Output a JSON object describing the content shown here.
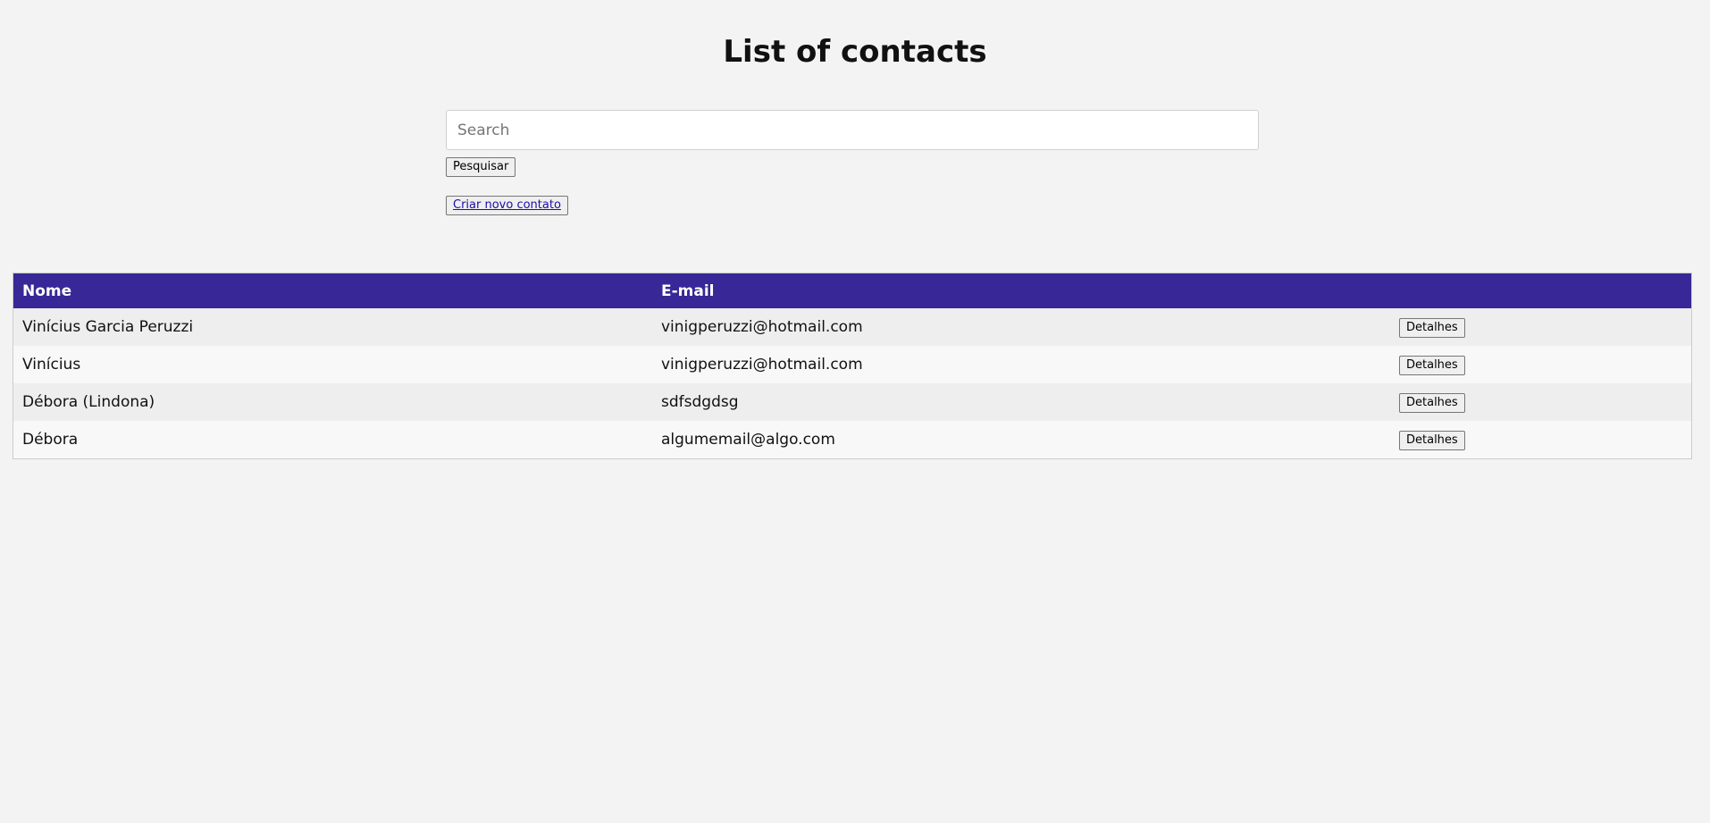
{
  "page": {
    "title": "List of contacts"
  },
  "search": {
    "placeholder": "Search",
    "value": "",
    "button_label": "Pesquisar"
  },
  "actions": {
    "create_label": "Criar novo contato"
  },
  "table": {
    "headers": {
      "name": "Nome",
      "email": "E-mail",
      "actions": ""
    },
    "rows": [
      {
        "name": "Vinícius Garcia Peruzzi",
        "email": "vinigperuzzi@hotmail.com",
        "action_label": "Detalhes"
      },
      {
        "name": "Vinícius",
        "email": "vinigperuzzi@hotmail.com",
        "action_label": "Detalhes"
      },
      {
        "name": "Débora (Lindona)",
        "email": "sdfsdgdsg",
        "action_label": "Detalhes"
      },
      {
        "name": "Débora",
        "email": "algumemail@algo.com",
        "action_label": "Detalhes"
      }
    ]
  },
  "colors": {
    "background": "#f3f3f3",
    "header_background": "#382796",
    "header_text": "#ffffff",
    "row_odd": "#eeeeee",
    "row_even": "#f8f8f8",
    "link": "#1a0dab"
  }
}
